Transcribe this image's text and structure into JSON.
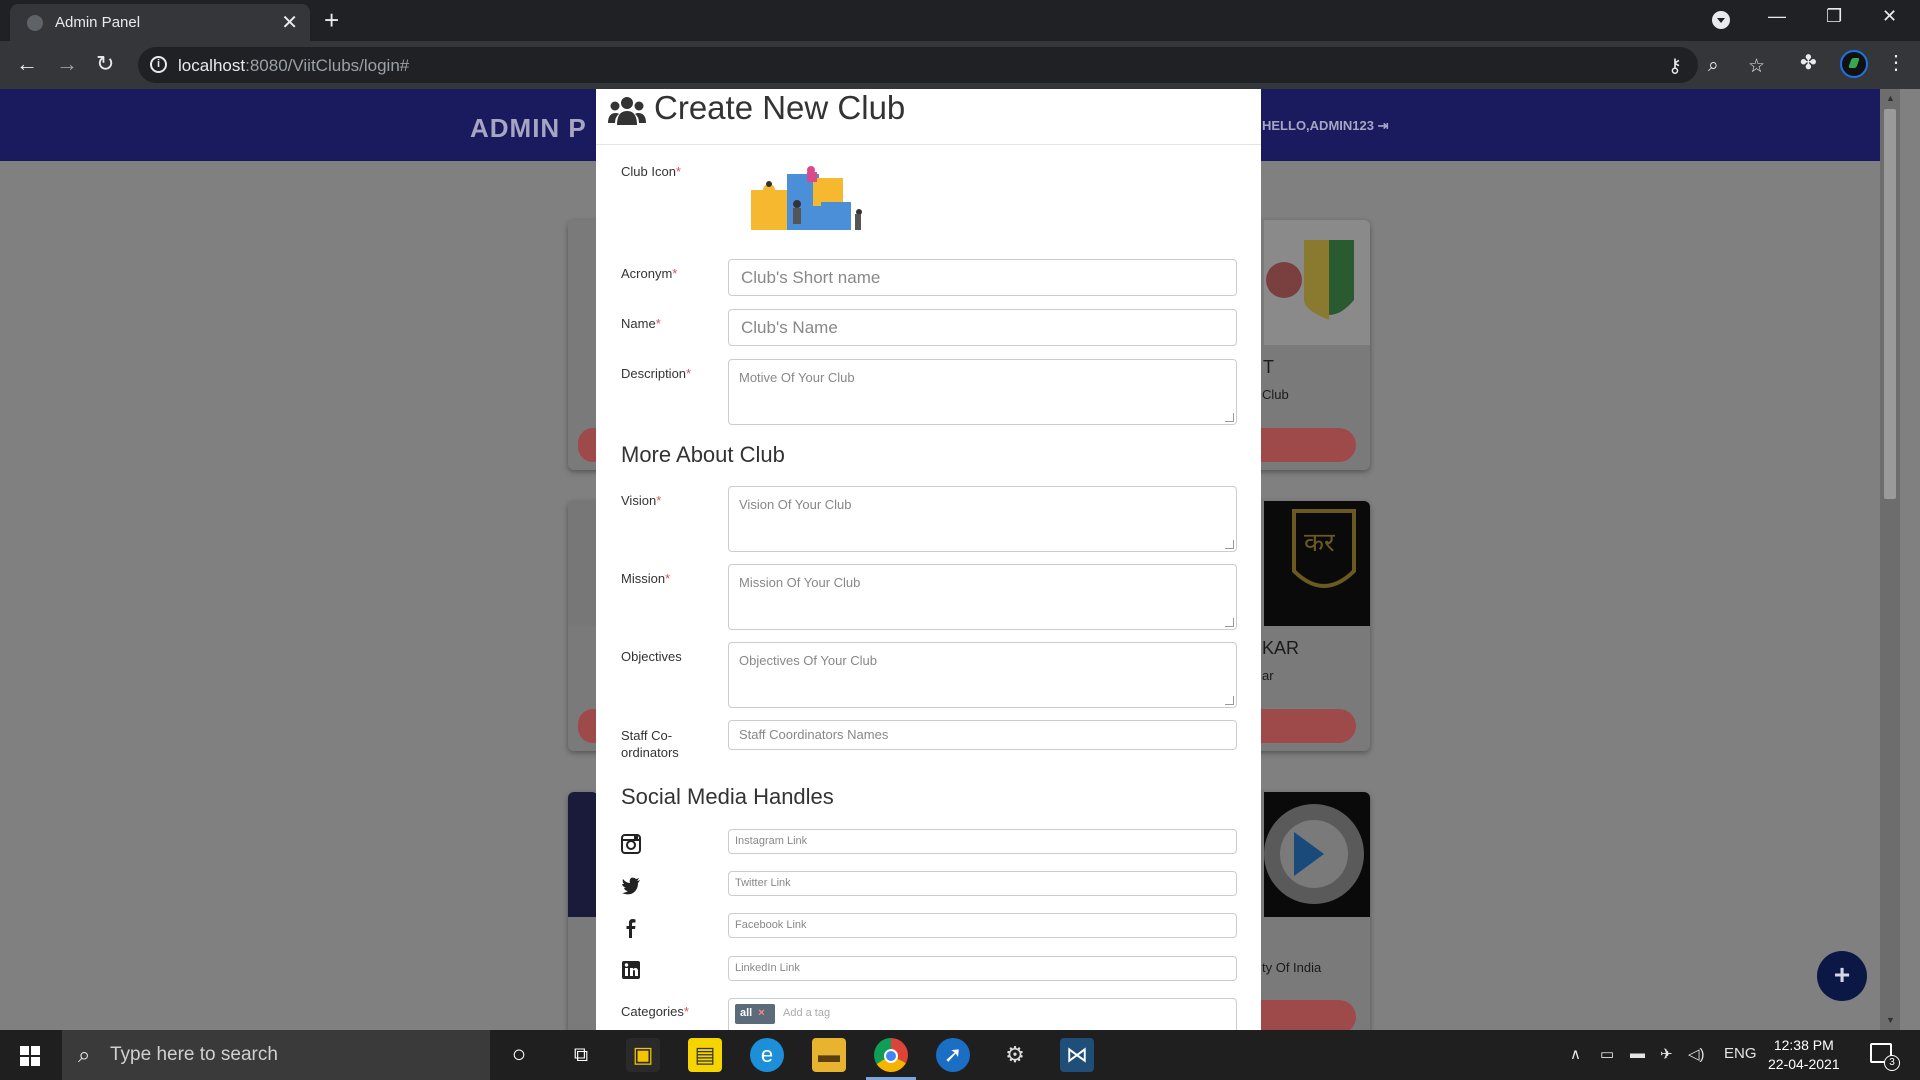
{
  "browser": {
    "tab_title": "Admin Panel",
    "url_host": "localhost",
    "url_rest": ":8080/ViitClubs/login#"
  },
  "page": {
    "brand": "ADMIN P",
    "hello": "HELLO,ADMIN123",
    "bg_text": {
      "t1": "T",
      "t2": "Club",
      "t3": "KAR",
      "t4": "ar",
      "t5": "ty Of India"
    }
  },
  "modal": {
    "title": "Create New Club",
    "labels": {
      "club_icon": "Club Icon",
      "acronym": "Acronym",
      "name": "Name",
      "description": "Description",
      "vision": "Vision",
      "mission": "Mission",
      "objectives": "Objectives",
      "staff_line1": "Staff Co-",
      "staff_line2": "ordinators",
      "categories": "Categories",
      "required_mark": "*"
    },
    "placeholders": {
      "acronym": "Club's Short name",
      "name": "Club's Name",
      "description": "Motive Of Your Club",
      "vision": "Vision Of Your Club",
      "mission": "Mission Of Your Club",
      "objectives": "Objectives Of Your Club",
      "staff": "Staff Coordinators Names",
      "instagram": "Instagram Link",
      "twitter": "Twitter Link",
      "facebook": "Facebook Link",
      "linkedin": "LinkedIn Link",
      "tag": "Add a tag"
    },
    "sections": {
      "more_about": "More About Club",
      "social": "Social Media Handles"
    },
    "tag": {
      "label": "all",
      "remove": "×"
    }
  },
  "taskbar": {
    "search_placeholder": "Type here to search",
    "lang": "ENG",
    "time": "12:38 PM",
    "date": "22-04-2021",
    "notifications": "3"
  }
}
